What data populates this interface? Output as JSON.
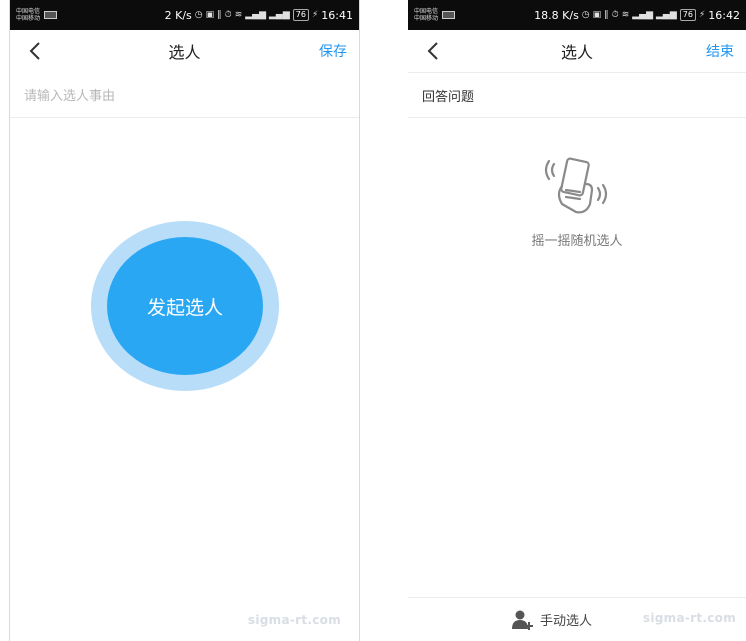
{
  "left_screen": {
    "status": {
      "carrier1": "中国电信",
      "carrier2": "中国移动",
      "net_speed": "2 K/s",
      "battery": "76",
      "time": "16:41"
    },
    "nav": {
      "title": "选人",
      "action": "保存"
    },
    "reason_placeholder": "请输入选人事由",
    "launch_button": "发起选人",
    "watermark": "sigma-rt.com"
  },
  "right_screen": {
    "status": {
      "carrier1": "中国电信",
      "carrier2": "中国移动",
      "net_speed": "18.8 K/s",
      "battery": "76",
      "time": "16:42"
    },
    "nav": {
      "title": "选人",
      "action": "结束"
    },
    "reason": "回答问题",
    "shake_label": "摇一摇随机选人",
    "manual_select": "手动选人",
    "watermark": "sigma-rt.com"
  },
  "colors": {
    "accent": "#2196f3",
    "button": "#2aa7f3",
    "halo": "#b7ddf9"
  }
}
